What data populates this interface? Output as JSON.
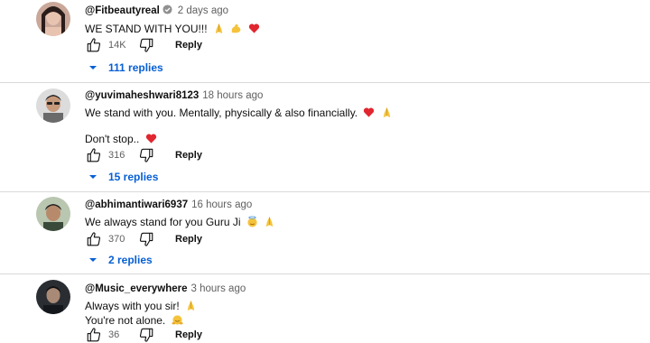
{
  "comments": [
    {
      "author": "@Fitbeautyreal",
      "verified": true,
      "time": "2 days ago",
      "lines": [
        "WE STAND WITH YOU!!!"
      ],
      "emojis": [
        "folded-hands",
        "flexed-biceps",
        "red-heart"
      ],
      "likes": "14K",
      "reply_label": "Reply",
      "replies_label": "111 replies"
    },
    {
      "author": "@yuvimaheshwari8123",
      "verified": false,
      "time": "18 hours ago",
      "lines": [
        "We stand with you. Mentally, physically & also financially.",
        "Don't stop.."
      ],
      "emojis": [
        "red-heart",
        "folded-hands",
        "red-heart"
      ],
      "likes": "316",
      "reply_label": "Reply",
      "replies_label": "15 replies"
    },
    {
      "author": "@abhimantiwari6937",
      "verified": false,
      "time": "16 hours ago",
      "lines": [
        "We always stand for you Guru Ji"
      ],
      "emojis": [
        "smiling-face-with-halo",
        "folded-hands"
      ],
      "likes": "370",
      "reply_label": "Reply",
      "replies_label": "2 replies"
    },
    {
      "author": "@Music_everywhere",
      "verified": false,
      "time": "3 hours ago",
      "lines": [
        "Always with you sir!",
        "You're not alone."
      ],
      "emojis": [
        "folded-hands",
        "hugging-face"
      ],
      "likes": "36",
      "reply_label": "Reply"
    }
  ],
  "colors": {
    "link_blue": "#065fd4",
    "meta_gray": "#606060",
    "divider": "#d9d9d9"
  }
}
